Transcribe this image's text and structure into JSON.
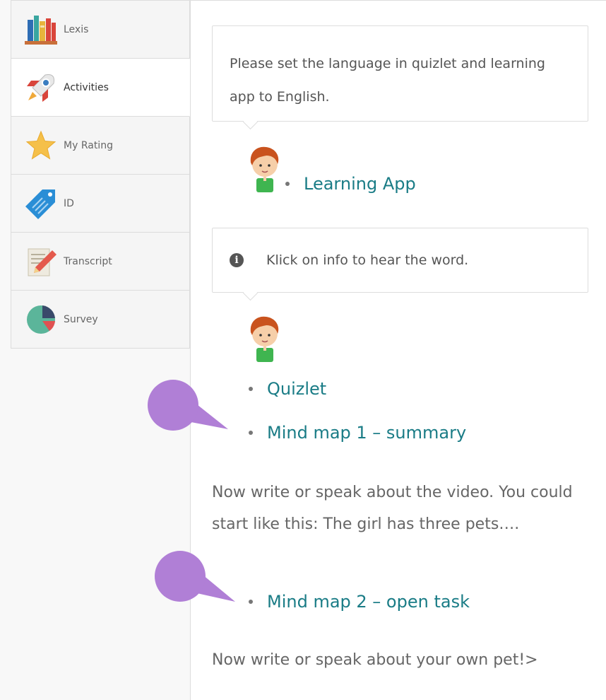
{
  "sidebar": {
    "items": [
      {
        "label": "Lexis",
        "icon": "books-icon",
        "active": false
      },
      {
        "label": "Activities",
        "icon": "rocket-icon",
        "active": true
      },
      {
        "label": "My Rating",
        "icon": "star-icon",
        "active": false
      },
      {
        "label": "ID",
        "icon": "tag-icon",
        "active": false
      },
      {
        "label": "Transcript",
        "icon": "notepad-pencil-icon",
        "active": false
      },
      {
        "label": "Survey",
        "icon": "pie-chart-icon",
        "active": false
      }
    ]
  },
  "main": {
    "tip1": {
      "text": "Please set the language in quizlet and learning app to English."
    },
    "link_learning_app": "Learning App",
    "tip2": {
      "text": "Klick on info to hear the word.",
      "icon": "info-icon"
    },
    "links": [
      "Quizlet",
      "Mind map 1 – summary"
    ],
    "paragraph1": "Now write or speak about the video. You could start like this: The girl has three pets….",
    "link_mindmap2": "Mind map 2 – open task",
    "paragraph2": "Now write or speak about your own pet!>"
  },
  "colors": {
    "link": "#1a7c86",
    "marker": "#b07fd6",
    "active_bg": "#ffffff",
    "inactive_bg": "#f5f5f5"
  }
}
